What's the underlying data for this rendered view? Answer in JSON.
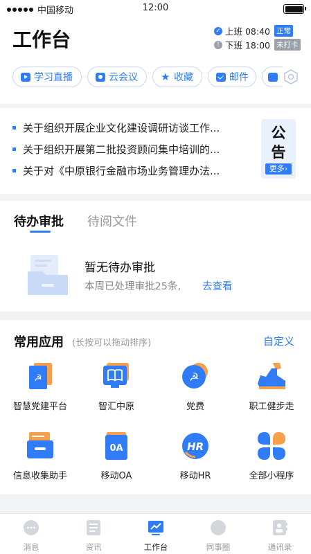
{
  "status_bar": {
    "carrier": "中国移动",
    "time": "12:00"
  },
  "header": {
    "title": "工作台",
    "clock_in": {
      "label": "上班 08:40",
      "status": "正常"
    },
    "clock_out": {
      "label": "下班 18:00",
      "status": "未打卡"
    }
  },
  "quick_links": [
    {
      "label": "学习直播",
      "icon": "play-icon"
    },
    {
      "label": "云会议",
      "icon": "meeting-icon"
    },
    {
      "label": "收藏",
      "icon": "star-icon"
    },
    {
      "label": "邮件",
      "icon": "mail-icon"
    },
    {
      "label": "",
      "icon": "document-icon"
    }
  ],
  "notices": {
    "items": [
      "关于组织开展企业文化建设调研访谈工作...",
      "关于组织开展第二批投资顾问集中培训的...",
      "关于对《中原银行金融市场业务管理办法..."
    ],
    "card_line1": "公",
    "card_line2": "告",
    "more_label": "更多"
  },
  "approval": {
    "tabs": [
      "待办审批",
      "待阅文件"
    ],
    "empty_title": "暂无待办审批",
    "empty_sub": "本周已处理审批25条,",
    "empty_link": "去查看"
  },
  "apps": {
    "title": "常用应用",
    "hint": "(长按可以拖动排序)",
    "customize_label": "自定义",
    "items": [
      {
        "label": "智慧党建平台",
        "icon": "party-building-icon"
      },
      {
        "label": "智汇中原",
        "icon": "book-monitor-icon"
      },
      {
        "label": "党费",
        "icon": "party-fee-icon"
      },
      {
        "label": "职工健步走",
        "icon": "sneaker-icon"
      },
      {
        "label": "信息收集助手",
        "icon": "inbox-tray-icon"
      },
      {
        "label": "移动OA",
        "icon": "oa-icon"
      },
      {
        "label": "移动HR",
        "icon": "hr-icon"
      },
      {
        "label": "全部小程序",
        "icon": "all-apps-icon"
      }
    ],
    "oa_glyph": "0A",
    "hr_glyph": "HR"
  },
  "tabbar": [
    {
      "label": "消息",
      "icon": "chat-bubble-icon"
    },
    {
      "label": "资讯",
      "icon": "news-icon"
    },
    {
      "label": "工作台",
      "icon": "workbench-icon"
    },
    {
      "label": "同事圈",
      "icon": "moments-icon"
    },
    {
      "label": "通讯录",
      "icon": "contacts-icon"
    }
  ],
  "colors": {
    "primary": "#2f7cf6",
    "accent_orange": "#f6a04d",
    "page_bg": "#f2f3f5"
  }
}
